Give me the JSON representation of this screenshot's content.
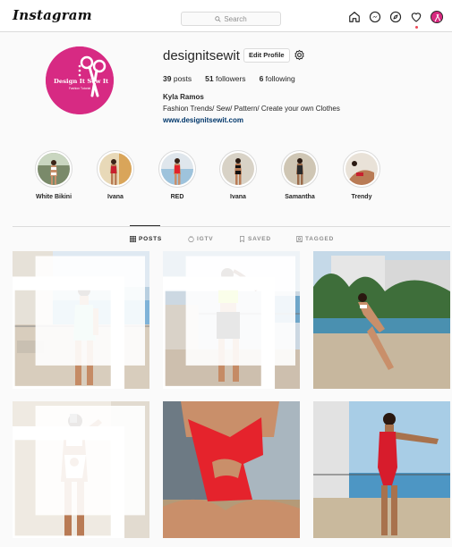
{
  "app": {
    "logo": "Instagram"
  },
  "search": {
    "placeholder": "Search",
    "icon": "search-icon"
  },
  "nav": {
    "icons": [
      "home-icon",
      "messenger-icon",
      "explore-icon",
      "heart-icon",
      "profile-avatar"
    ]
  },
  "profile": {
    "username": "designitsewit",
    "edit_label": "Edit Profile",
    "posts_count": "39",
    "posts_label": "posts",
    "followers_count": "51",
    "followers_label": "followers",
    "following_count": "6",
    "following_label": "following",
    "full_name": "Kyla Ramos",
    "bio": "Fashion Trends/ Sew/ Pattern/ Create your own Clothes",
    "website": "www.designitsewit.com",
    "logo_text": "Design It Sew It",
    "logo_tagline": "Fashion Tutorial",
    "brand_color": "#d72a83"
  },
  "highlights": [
    {
      "label": "White Bikini"
    },
    {
      "label": "Ivana"
    },
    {
      "label": "RED"
    },
    {
      "label": "Ivana"
    },
    {
      "label": "Samantha"
    },
    {
      "label": "Trendy"
    }
  ],
  "tabs": [
    {
      "label": "POSTS",
      "active": true,
      "icon": "grid-icon"
    },
    {
      "label": "IGTV",
      "active": false,
      "icon": "igtv-icon"
    },
    {
      "label": "SAVED",
      "active": false,
      "icon": "bookmark-icon"
    },
    {
      "label": "TAGGED",
      "active": false,
      "icon": "tagged-icon"
    }
  ],
  "posts": [
    {
      "description": "mint green swimsuit on balcony",
      "multi": true
    },
    {
      "description": "lime crop top and black biker shorts",
      "multi": true
    },
    {
      "description": "white bikini by infinity pool",
      "multi": false
    },
    {
      "description": "white cutout swimsuit selfie",
      "multi": true
    },
    {
      "description": "red one-shoulder cutout swimsuit",
      "multi": false
    },
    {
      "description": "red high-cut swimsuit on balcony",
      "multi": false
    }
  ],
  "colors": {
    "link": "#00376b",
    "border": "#dbdbdb",
    "accent_pink": "#d72a83",
    "notification": "#ed4956"
  }
}
